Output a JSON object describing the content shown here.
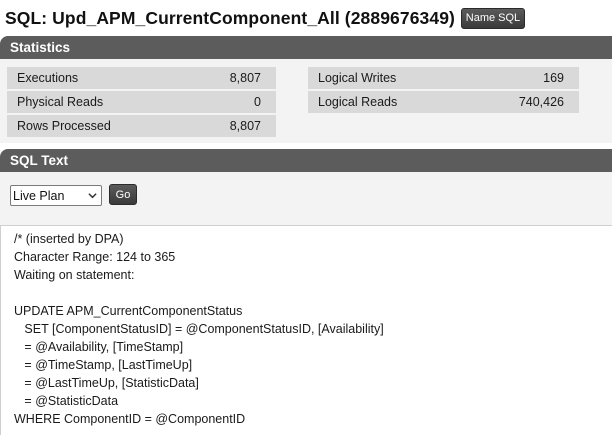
{
  "header": {
    "title": "SQL: Upd_APM_CurrentComponent_All (2889676349)",
    "name_sql_button": "Name SQL"
  },
  "statistics": {
    "section_title": "Statistics",
    "left": [
      {
        "label": "Executions",
        "value": "8,807"
      },
      {
        "label": "Physical Reads",
        "value": "0"
      },
      {
        "label": "Rows Processed",
        "value": "8,807"
      }
    ],
    "right": [
      {
        "label": "Logical Writes",
        "value": "169"
      },
      {
        "label": "Logical Reads",
        "value": "740,426"
      }
    ]
  },
  "sql_text": {
    "section_title": "SQL Text",
    "plan_select": {
      "selected": "Live Plan"
    },
    "go_button": "Go",
    "lines": [
      "/* (inserted by DPA)",
      "Character Range: 124 to 365",
      "Waiting on statement:",
      "",
      "UPDATE APM_CurrentComponentStatus",
      "   SET [ComponentStatusID] = @ComponentStatusID, [Availability]",
      "   = @Availability, [TimeStamp]",
      "   = @TimeStamp, [LastTimeUp]",
      "   = @LastTimeUp, [StatisticData]",
      "   = @StatisticData",
      "WHERE ComponentID = @ComponentID"
    ]
  },
  "icons": {
    "select_caret": "chevron-down-icon"
  },
  "colors": {
    "section_header_bg": "#5c5c5c",
    "stat_row_bg": "#d9d9d9",
    "button_bg": "#4a4a4a"
  }
}
